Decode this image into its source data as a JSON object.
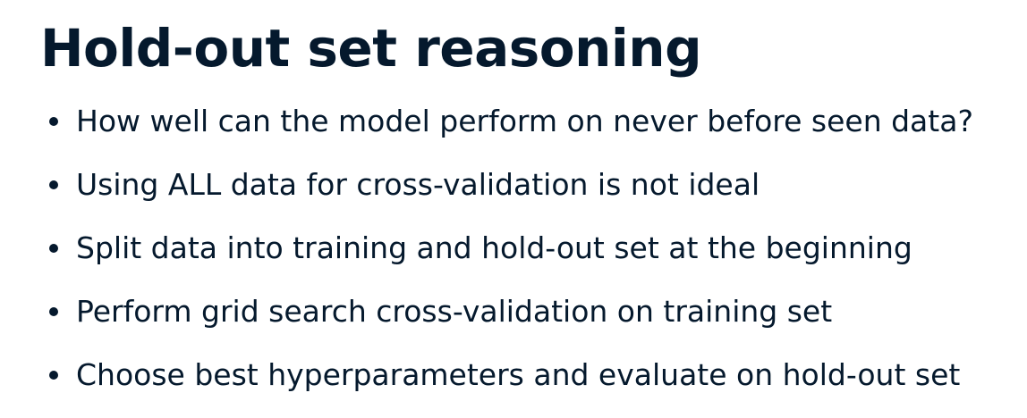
{
  "slide": {
    "title": "Hold-out set reasoning",
    "bullets": [
      "How well can the model perform on never before seen data?",
      "Using ALL data for cross-validation is not ideal",
      "Split data into training and hold-out set at the beginning",
      "Perform grid search cross-validation on training set",
      "Choose best hyperparameters and evaluate on hold-out set"
    ]
  },
  "colors": {
    "text": "#05192d",
    "background": "#ffffff"
  }
}
